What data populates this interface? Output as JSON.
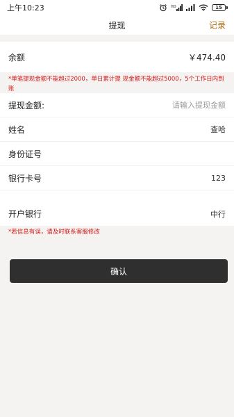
{
  "status_bar": {
    "time": "上午10:23",
    "signal_label": "HD",
    "battery": "15"
  },
  "nav": {
    "title": "提现",
    "action": "记录"
  },
  "balance": {
    "label": "余额",
    "value": "￥474.40"
  },
  "notice": "*单笔提现金额不能超过2000，单日累计提 现金额不能超过5000，5个工作日内到账",
  "form": {
    "amount_label": "提现金额:",
    "amount_placeholder": "请输入提现金额",
    "name_label": "姓名",
    "name_value": "查哈",
    "id_label": "身份证号",
    "id_value": "",
    "card_label": "银行卡号",
    "card_value": "123",
    "bank_label": "开户银行",
    "bank_value": "中行"
  },
  "tip": "*若信息有误，请及时联系客服修改",
  "confirm_label": "确认",
  "colors": {
    "accent": "#b4690e",
    "warning": "#d41919",
    "button": "#2f2f2f",
    "background": "#f5f3f1"
  }
}
